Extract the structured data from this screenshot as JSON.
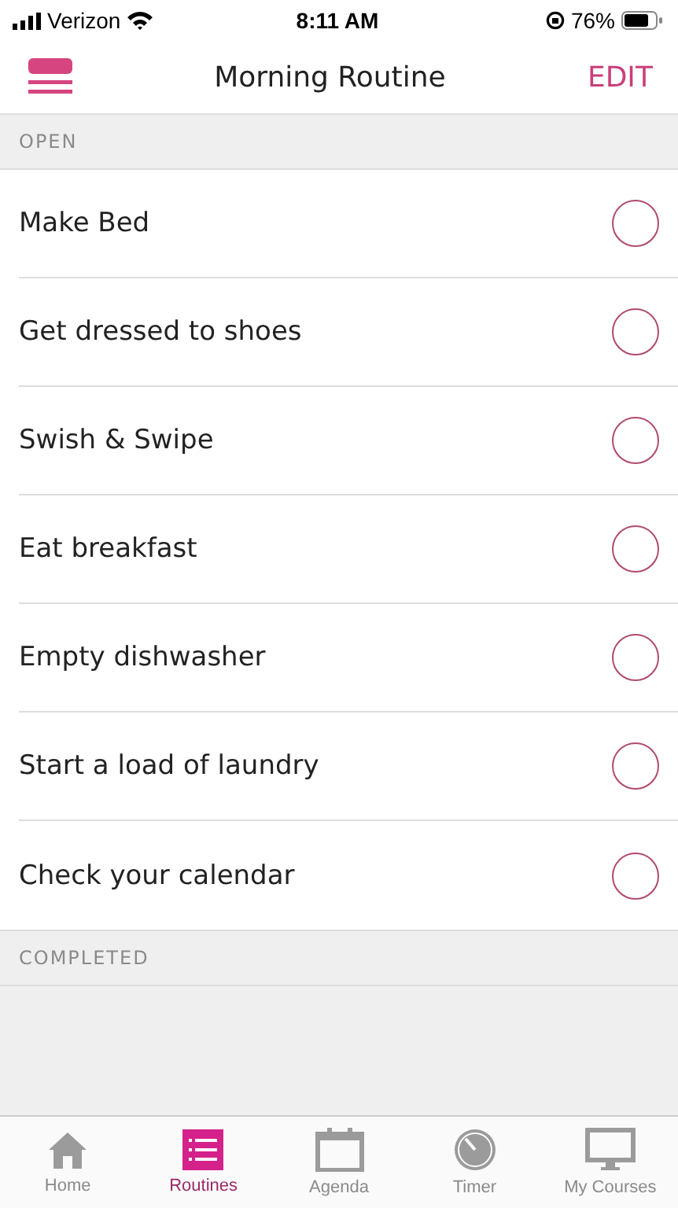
{
  "status_bar": {
    "carrier": "Verizon",
    "time": "8:11 AM",
    "battery": "76%"
  },
  "nav": {
    "title": "Morning Routine",
    "action": "EDIT"
  },
  "sections": [
    {
      "title": "OPEN",
      "tasks": [
        {
          "label": "Make Bed",
          "checked": false
        },
        {
          "label": "Get dressed to shoes",
          "checked": false
        },
        {
          "label": "Swish & Swipe",
          "checked": false
        },
        {
          "label": "Eat breakfast",
          "checked": false
        },
        {
          "label": "Empty dishwasher",
          "checked": false
        },
        {
          "label": "Start a load of laundry",
          "checked": false
        },
        {
          "label": "Check your calendar",
          "checked": false
        }
      ]
    },
    {
      "title": "COMPLETED"
    }
  ],
  "tabs": [
    {
      "label": "Home",
      "kind": "home",
      "selected": false
    },
    {
      "label": "Routines",
      "kind": "list",
      "selected": true
    },
    {
      "label": "Agenda",
      "kind": "calendar",
      "selected": false
    },
    {
      "label": "Timer",
      "kind": "timer",
      "selected": false
    },
    {
      "label": "My Courses",
      "kind": "monitor",
      "selected": false
    }
  ]
}
